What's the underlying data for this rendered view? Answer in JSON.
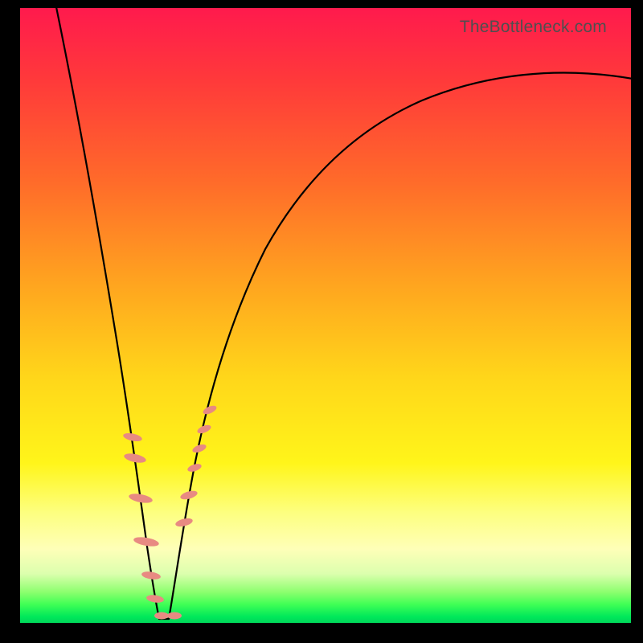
{
  "watermark": "TheBottleneck.com",
  "colors": {
    "frame": "#000000",
    "curve": "#000000",
    "marker": "#e88a82",
    "gradient_stops": [
      "#ff1a4d",
      "#ff3a3a",
      "#ff6a2a",
      "#ffa51f",
      "#ffd61a",
      "#fff51a",
      "#fdff7f",
      "#feffb8",
      "#dcffae",
      "#8cff6e",
      "#3fff55",
      "#00e85a",
      "#00d65a"
    ]
  },
  "chart_data": {
    "type": "line",
    "title": "",
    "xlabel": "",
    "ylabel": "",
    "xlim": [
      0,
      100
    ],
    "ylim": [
      0,
      100
    ],
    "notes": "Two curves forming a V centered near x≈22. Left branch starts at top-left (x≈5,y≈100) descending to bottom at x≈22. Right branch rises from x≈22,y≈0 asymptotically toward ~y≈88 at x=100. Lower y (closer to 0) is better (green).",
    "series": [
      {
        "name": "left-branch",
        "x": [
          5,
          7,
          9,
          11,
          13,
          15,
          17,
          19,
          20,
          21,
          22
        ],
        "y": [
          100,
          90,
          79,
          67,
          55,
          42,
          29,
          15,
          8,
          3,
          0
        ]
      },
      {
        "name": "right-branch",
        "x": [
          22,
          23,
          25,
          27,
          30,
          35,
          40,
          45,
          50,
          60,
          70,
          80,
          90,
          100
        ],
        "y": [
          0,
          4,
          13,
          22,
          33,
          47,
          57,
          64,
          69,
          76,
          81,
          84,
          86,
          88
        ]
      }
    ],
    "markers": {
      "description": "Highlighted sample points (pink elongated beads) near the valley of the V on both branches.",
      "points": [
        {
          "branch": "left",
          "x": 17.0,
          "y": 29
        },
        {
          "branch": "left",
          "x": 17.5,
          "y": 25
        },
        {
          "branch": "left",
          "x": 18.5,
          "y": 18
        },
        {
          "branch": "left",
          "x": 19.5,
          "y": 11
        },
        {
          "branch": "left",
          "x": 20.3,
          "y": 6
        },
        {
          "branch": "left",
          "x": 21.0,
          "y": 3
        },
        {
          "branch": "right",
          "x": 22.5,
          "y": 1
        },
        {
          "branch": "right",
          "x": 24.0,
          "y": 2
        },
        {
          "branch": "right",
          "x": 25.0,
          "y": 2
        },
        {
          "branch": "right",
          "x": 26.5,
          "y": 20
        },
        {
          "branch": "right",
          "x": 27.5,
          "y": 24
        },
        {
          "branch": "right",
          "x": 28.5,
          "y": 29
        },
        {
          "branch": "right",
          "x": 29.5,
          "y": 32
        },
        {
          "branch": "right",
          "x": 30.5,
          "y": 35
        }
      ]
    }
  }
}
